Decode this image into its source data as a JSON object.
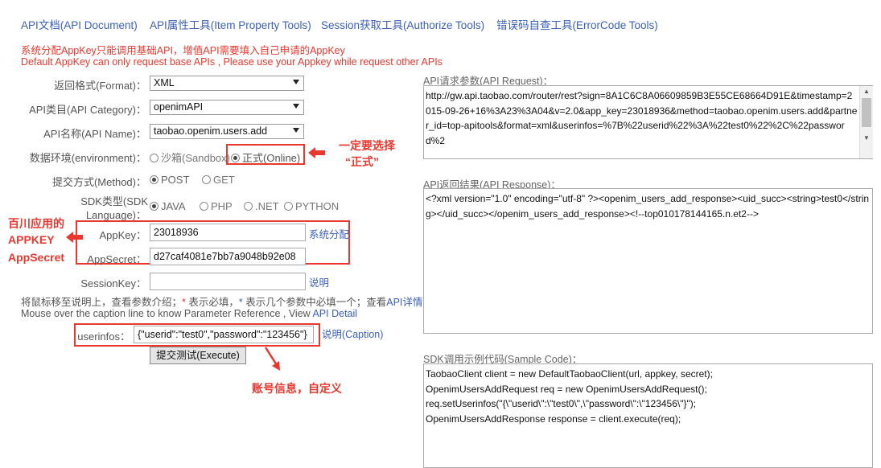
{
  "nav": {
    "api_doc": "API文档(API Document)",
    "item_property": "API属性工具(Item Property Tools)",
    "session": "Session获取工具(Authorize Tools)",
    "errorcode": "错误码自查工具(ErrorCode Tools)"
  },
  "warning": {
    "cn": "系统分配AppKey只能调用基础API，增值API需要填入自己申请的AppKey",
    "en": "Default AppKey can only request base APIs , Please use your Appkey while request other APIs"
  },
  "form": {
    "format_label": "返回格式(Format)：",
    "format_value": "XML",
    "category_label": "API类目(API Category)：",
    "category_value": "openimAPI",
    "name_label": "API名称(API Name)：",
    "name_value": "taobao.openim.users.add",
    "env_label": "数据环境(environment)：",
    "env_sandbox": "沙箱(Sandbox)",
    "env_online": "正式(Online)",
    "method_label": "提交方式(Method)：",
    "method_post": "POST",
    "method_get": "GET",
    "sdk_label_1": "SDK类型(SDK",
    "sdk_label_2": "Language)：",
    "sdk_java": "JAVA",
    "sdk_php": "PHP",
    "sdk_net": ".NET",
    "sdk_python": "PYTHON",
    "appkey_label": "AppKey：",
    "appkey_value": "23018936",
    "appkey_link": "系统分配",
    "appsecret_label": "AppSecret：",
    "appsecret_value": "d27caf4081e7bb7a9048b92e08",
    "sessionkey_label": "SessionKey：",
    "sessionkey_value": "",
    "sessionkey_link": "说明",
    "hint_cn_prefix": "将鼠标移至说明上，查看参数介绍；",
    "hint_star1": "*",
    "hint_required": " 表示必填，",
    "hint_star2": "*",
    "hint_oneof": " 表示几个参数中必填一个；查看",
    "hint_api_link": "API详情",
    "hint_en_prefix": "Mouse over the caption line to know Parameter Reference , View ",
    "hint_en_link": "API Detail",
    "userinfos_label": "userinfos：",
    "userinfos_value": "{\"userid\":\"test0\",\"password\":\"123456\"}",
    "userinfos_link": "说明(Caption)",
    "execute_button": "提交测试(Execute)"
  },
  "annotations": {
    "online_1": "一定要选择",
    "online_2": "“正式”",
    "appkey_1": "百川应用的",
    "appkey_2": "APPKEY",
    "appkey_3": "AppSecret",
    "account": "账号信息，自定义"
  },
  "request": {
    "title": "API请求参数(API Request)：",
    "content": "http://gw.api.taobao.com/router/rest?sign=8A1C6C8A06609859B3E55CE68664D91E&timestamp=2015-09-26+16%3A23%3A04&v=2.0&app_key=23018936&method=taobao.openim.users.add&partner_id=top-apitools&format=xml&userinfos=%7B%22userid%22%3A%22test0%22%2C%22password%2"
  },
  "response": {
    "title": "API返回结果(API Response)：",
    "content": "<?xml version=\"1.0\" encoding=\"utf-8\" ?><openim_users_add_response><uid_succ><string>test0</string></uid_succ></openim_users_add_response><!--top010178144165.n.et2-->"
  },
  "sample": {
    "title": "SDK调用示例代码(Sample Code)：",
    "line1": "TaobaoClient client = new DefaultTaobaoClient(url, appkey, secret);",
    "line2": "OpenimUsersAddRequest req = new OpenimUsersAddRequest();",
    "line3": "req.setUserinfos(\"{\\\"userid\\\":\\\"test0\\\",\\\"password\\\":\\\"123456\\\"}\");",
    "line4": "OpenimUsersAddResponse response = client.execute(req);"
  },
  "colors": {
    "link": "#3b5fbd",
    "annotation_red": "#e8382f"
  }
}
